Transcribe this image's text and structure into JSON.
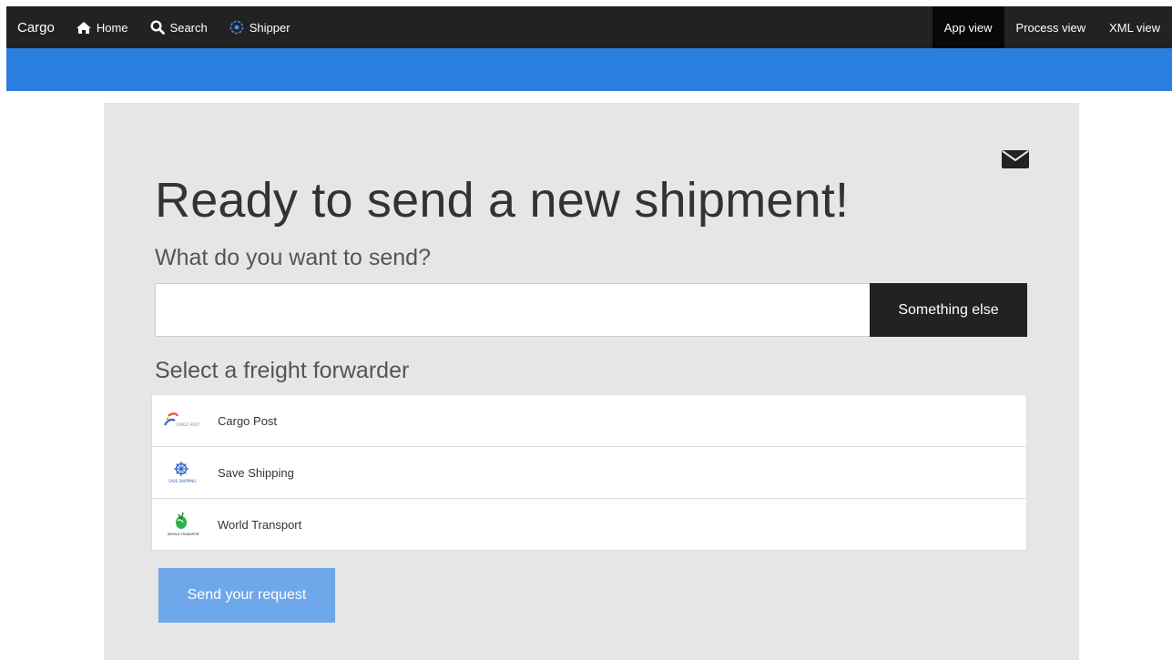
{
  "nav": {
    "brand": "Cargo",
    "home": "Home",
    "search": "Search",
    "shipper": "Shipper",
    "views": [
      "App view",
      "Process view",
      "XML view"
    ],
    "active_view": "App view"
  },
  "colors": {
    "navbar": "#222222",
    "accent_bar": "#2a7ee0",
    "panel": "#e6e6e6",
    "send_button": "#6ea8ea"
  },
  "main": {
    "title": "Ready to send a new shipment!",
    "question": "What do you want to send?",
    "input_value": "",
    "something_else_label": "Something else",
    "forwarder_label": "Select a freight forwarder",
    "forwarders": [
      {
        "name": "Cargo Post",
        "logo_text": "CARGO POST"
      },
      {
        "name": "Save Shipping",
        "logo_text": "SAVE SHIPPING"
      },
      {
        "name": "World Transport",
        "logo_text": "WORLD TRANSPORT"
      }
    ],
    "send_label": "Send your request"
  }
}
